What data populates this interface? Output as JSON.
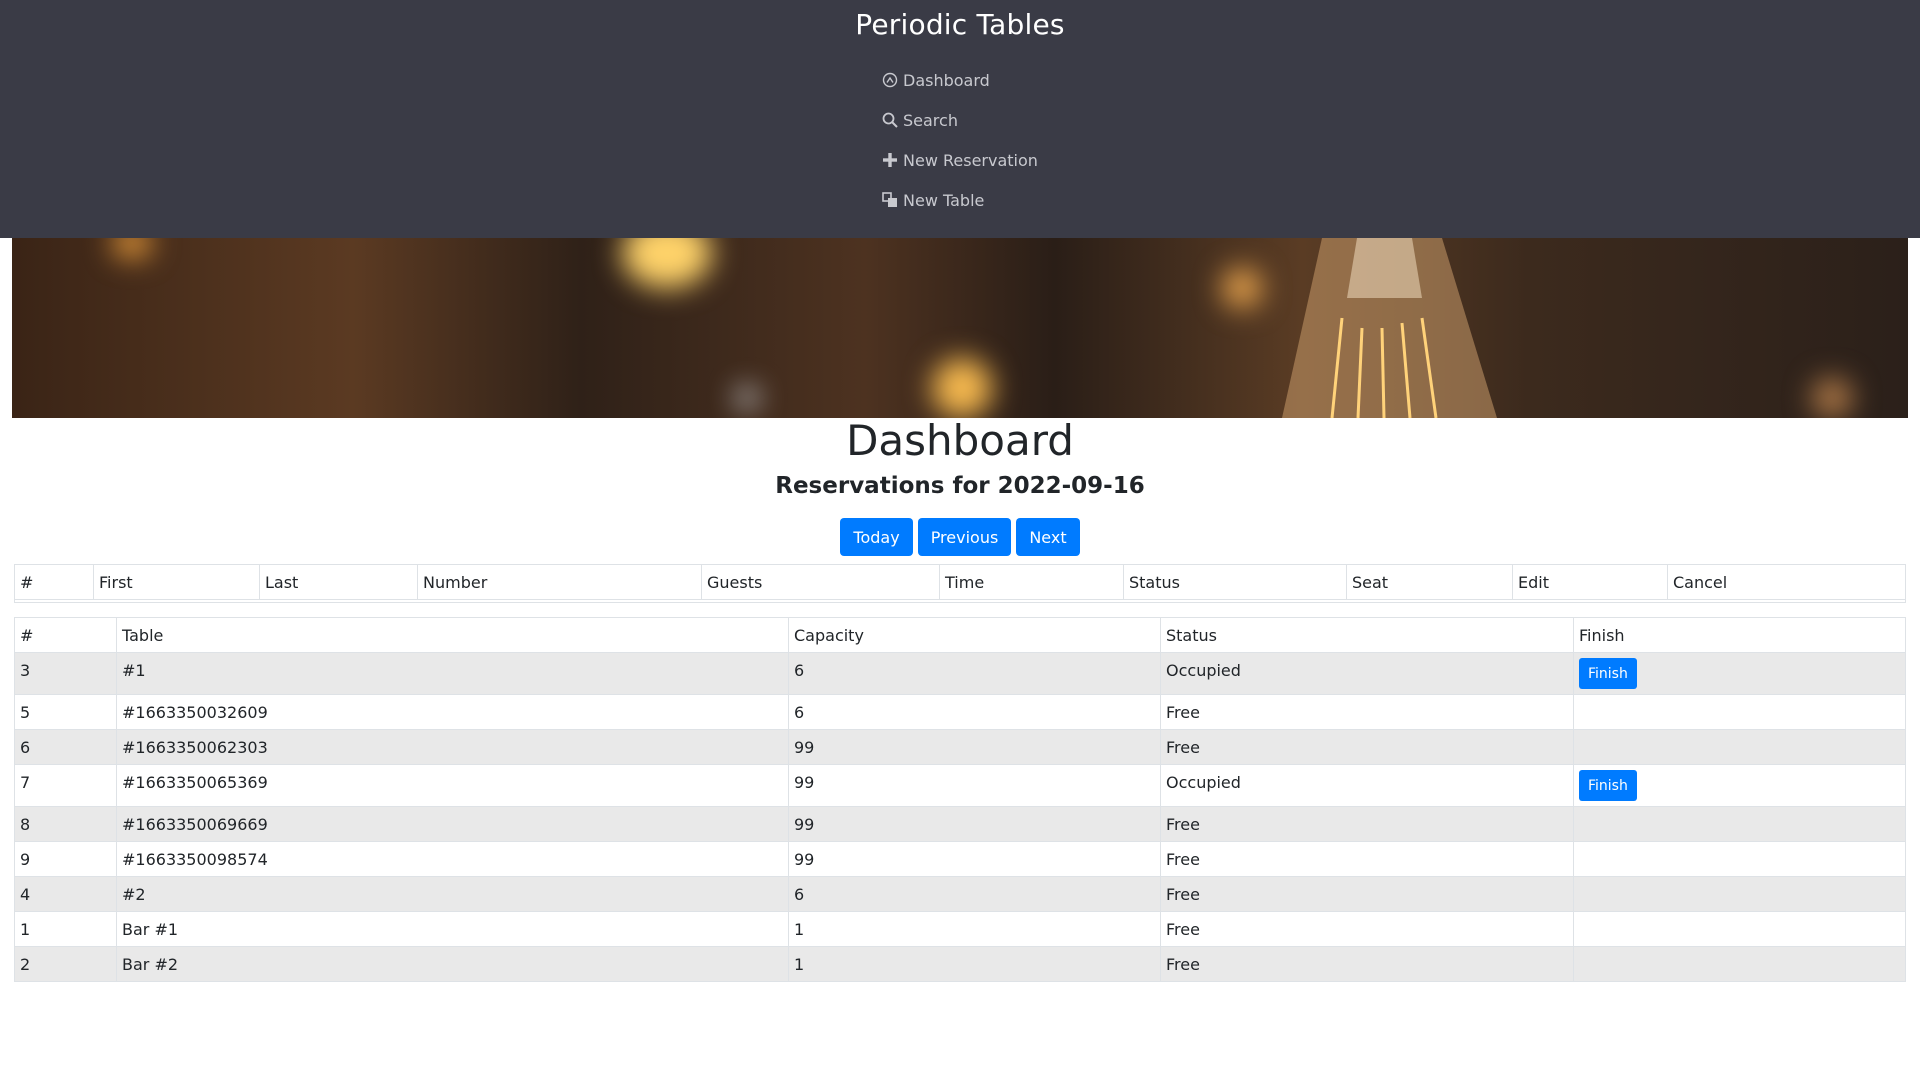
{
  "app": {
    "title": "Periodic Tables"
  },
  "nav": [
    {
      "label": "Dashboard",
      "icon": "dashboard-icon"
    },
    {
      "label": "Search",
      "icon": "search-icon"
    },
    {
      "label": "New Reservation",
      "icon": "plus-icon"
    },
    {
      "label": "New Table",
      "icon": "table-icon"
    }
  ],
  "page": {
    "title": "Dashboard",
    "subtitle": "Reservations for 2022-09-16",
    "buttons": {
      "today": "Today",
      "previous": "Previous",
      "next": "Next"
    }
  },
  "reservations": {
    "headers": [
      "#",
      "First",
      "Last",
      "Number",
      "Guests",
      "Time",
      "Status",
      "Seat",
      "Edit",
      "Cancel"
    ],
    "rows": []
  },
  "tables": {
    "headers": [
      "#",
      "Table",
      "Capacity",
      "Status",
      "Finish"
    ],
    "finish_label": "Finish",
    "rows": [
      {
        "id": "3",
        "name": "#1",
        "capacity": "6",
        "status": "Occupied",
        "finish": true
      },
      {
        "id": "5",
        "name": "#1663350032609",
        "capacity": "6",
        "status": "Free",
        "finish": false
      },
      {
        "id": "6",
        "name": "#1663350062303",
        "capacity": "99",
        "status": "Free",
        "finish": false
      },
      {
        "id": "7",
        "name": "#1663350065369",
        "capacity": "99",
        "status": "Occupied",
        "finish": true
      },
      {
        "id": "8",
        "name": "#1663350069669",
        "capacity": "99",
        "status": "Free",
        "finish": false
      },
      {
        "id": "9",
        "name": "#1663350098574",
        "capacity": "99",
        "status": "Free",
        "finish": false
      },
      {
        "id": "4",
        "name": "#2",
        "capacity": "6",
        "status": "Free",
        "finish": false
      },
      {
        "id": "1",
        "name": "Bar #1",
        "capacity": "1",
        "status": "Free",
        "finish": false
      },
      {
        "id": "2",
        "name": "Bar #2",
        "capacity": "1",
        "status": "Free",
        "finish": false
      }
    ]
  },
  "colors": {
    "header_bg": "#3a3b46",
    "accent": "#007bff",
    "stripe": "#e9e9e9",
    "nav_text": "#c8c9cf"
  }
}
